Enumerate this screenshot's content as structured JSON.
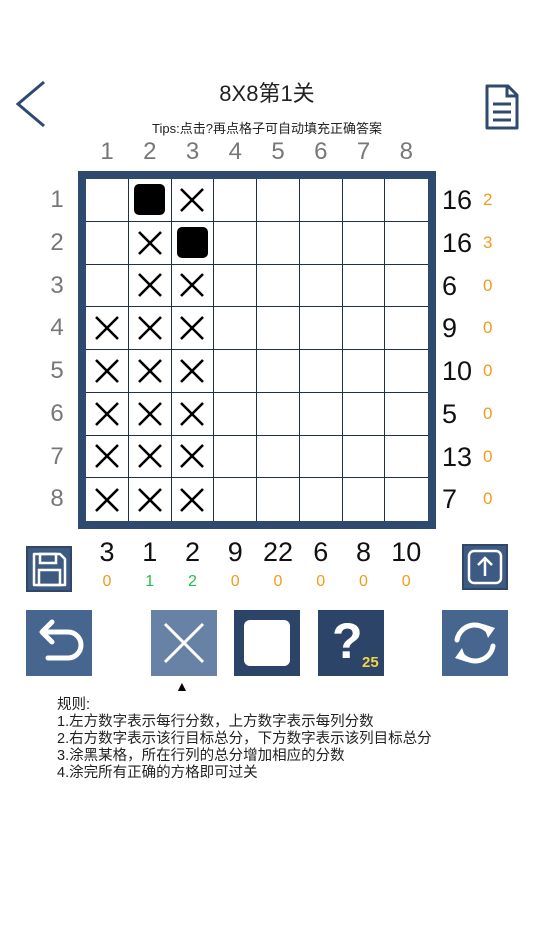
{
  "header": {
    "title": "8X8第1关",
    "tips": "Tips:点击?再点格子可自动填充正确答案"
  },
  "col_headers": [
    "1",
    "2",
    "3",
    "4",
    "5",
    "6",
    "7",
    "8"
  ],
  "row_headers": [
    "1",
    "2",
    "3",
    "4",
    "5",
    "6",
    "7",
    "8"
  ],
  "grid": [
    [
      "",
      "filled",
      "x",
      "",
      "",
      "",
      "",
      ""
    ],
    [
      "",
      "x",
      "filled",
      "",
      "",
      "",
      "",
      ""
    ],
    [
      "",
      "x",
      "x",
      "",
      "",
      "",
      "",
      ""
    ],
    [
      "x",
      "x",
      "x",
      "",
      "",
      "",
      "",
      ""
    ],
    [
      "x",
      "x",
      "x",
      "",
      "",
      "",
      "",
      ""
    ],
    [
      "x",
      "x",
      "x",
      "",
      "",
      "",
      "",
      ""
    ],
    [
      "x",
      "x",
      "x",
      "",
      "",
      "",
      "",
      ""
    ],
    [
      "x",
      "x",
      "x",
      "",
      "",
      "",
      "",
      ""
    ]
  ],
  "row_targets": [
    "16",
    "16",
    "6",
    "9",
    "10",
    "5",
    "13",
    "7"
  ],
  "row_scores": [
    "2",
    "3",
    "0",
    "0",
    "0",
    "0",
    "0",
    "0"
  ],
  "col_targets": [
    "3",
    "1",
    "2",
    "9",
    "22",
    "6",
    "8",
    "10"
  ],
  "col_scores": [
    "0",
    "1",
    "2",
    "0",
    "0",
    "0",
    "0",
    "0"
  ],
  "colors": {
    "board": "#2f4a6f",
    "orange_score": "#f39a1d",
    "green_score": "#22c04b"
  },
  "tools": {
    "hint_count": "25",
    "selected": "cross"
  },
  "rules": {
    "title": "规则:",
    "line1": "1.左方数字表示每行分数，上方数字表示每列分数",
    "line2": "2.右方数字表示该行目标总分，下方数字表示该列目标总分",
    "line3": "3.涂黑某格，所在行列的总分增加相应的分数",
    "line4": "4.涂完所有正确的方格即可过关"
  }
}
